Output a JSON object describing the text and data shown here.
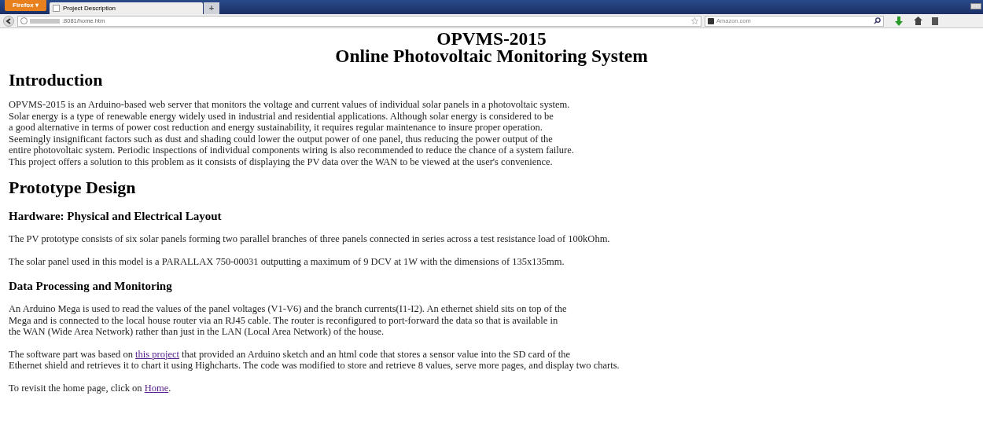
{
  "browser": {
    "menu_button": "Firefox ▾",
    "tabs": [
      {
        "title": "Project Description",
        "selected": true
      }
    ],
    "new_tab": "+",
    "url": ":8081/home.htm",
    "search_placeholder": "Amazon.com"
  },
  "page": {
    "title_lines": [
      "OPVMS-2015",
      "Online Photovoltaic Monitoring System"
    ],
    "sections": [
      {
        "kind": "h2",
        "text": "Introduction"
      },
      {
        "kind": "p",
        "lines": [
          [
            {
              "text": "OPVMS-2015 is an Arduino-based web server that monitors the voltage and current values of individual solar panels in a photovoltaic system."
            }
          ],
          [
            {
              "text": "Solar energy is a type of renewable energy widely used in industrial and residential applications. Although solar energy is considered to be"
            }
          ],
          [
            {
              "text": "a good alternative in terms of power cost reduction and energy sustainability, it requires regular maintenance to insure proper operation."
            }
          ],
          [
            {
              "text": "Seemingly insignificant factors such as dust and shading could lower the output power of one panel, thus reducing the power output of the"
            }
          ],
          [
            {
              "text": "entire photovoltaic system. Periodic inspections of individual components wiring is also recommended to reduce the chance of a system failure."
            }
          ],
          [
            {
              "text": "This project offers a solution to this problem as it consists of displaying the PV data over the WAN to be viewed at the user's convenience."
            }
          ]
        ]
      },
      {
        "kind": "h2",
        "text": "Prototype Design"
      },
      {
        "kind": "h3",
        "text": "Hardware: Physical and Electrical Layout"
      },
      {
        "kind": "p",
        "lines": [
          [
            {
              "text": "The PV prototype consists of six solar panels forming two parallel branches of three panels connected in series across a test resistance load of 100kOhm."
            }
          ]
        ]
      },
      {
        "kind": "p",
        "lines": [
          [
            {
              "text": "The solar panel used in this model is a PARALLAX 750-00031 outputting a maximum of 9 DCV at 1W with the dimensions of 135x135mm."
            }
          ]
        ]
      },
      {
        "kind": "h3",
        "text": "Data Processing and Monitoring"
      },
      {
        "kind": "p",
        "lines": [
          [
            {
              "text": "An Arduino Mega is used to read the values of the panel voltages (V1-V6) and the branch currents(I1-I2). An ethernet shield sits on top of the"
            }
          ],
          [
            {
              "text": "Mega and is connected to the local house router via an RJ45 cable. The router is reconfigured to port-forward the data so that is available in"
            }
          ],
          [
            {
              "text": "the WAN (Wide Area Network) rather than just in the LAN (Local Area Network) of the house."
            }
          ]
        ]
      },
      {
        "kind": "p",
        "lines": [
          [
            {
              "text": "The software part was based on "
            },
            {
              "text": "this project",
              "link": true
            },
            {
              "text": " that provided an Arduino sketch and an html code that stores a sensor value into the SD card of the"
            }
          ],
          [
            {
              "text": "Ethernet shield and retrieves it to chart it using Highcharts. The code was modified to store and retrieve 8 values, serve more pages, and display two charts."
            }
          ]
        ]
      },
      {
        "kind": "p",
        "lines": [
          [
            {
              "text": "To revisit the home page, click on "
            },
            {
              "text": "Home",
              "link": true
            },
            {
              "text": "."
            }
          ]
        ]
      }
    ]
  }
}
